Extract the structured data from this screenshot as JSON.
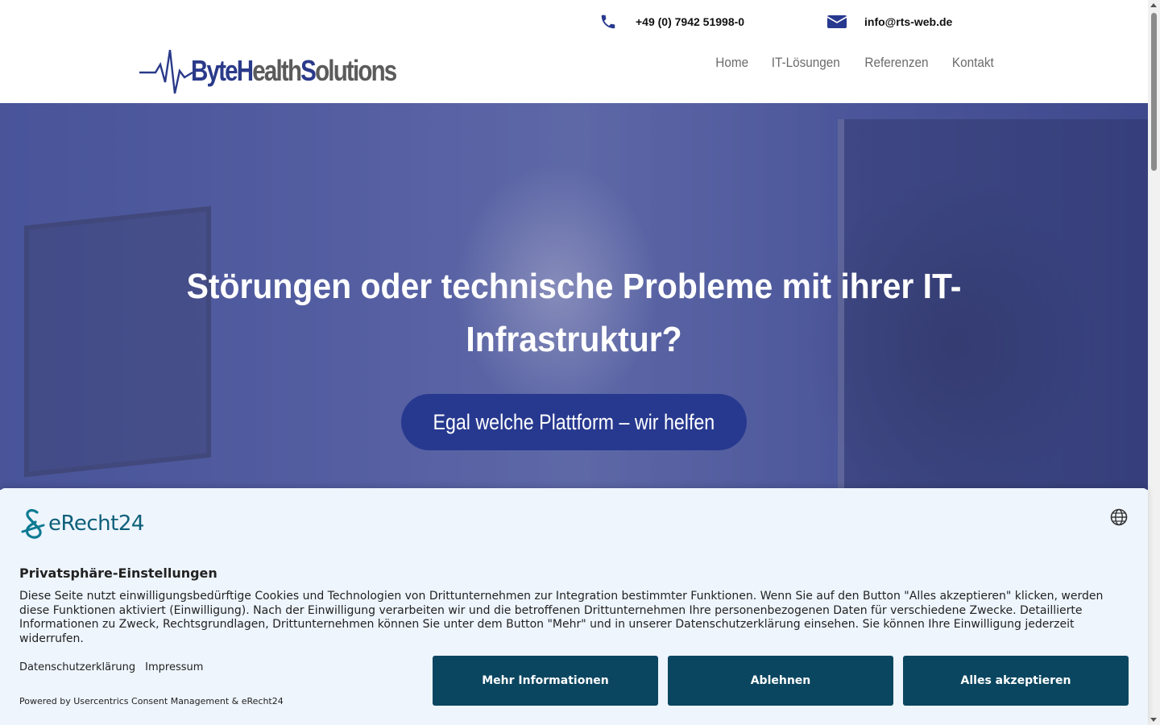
{
  "header": {
    "phone": "+49 (0) 7942 51998-0",
    "email": "info@rts-web.de",
    "logo": {
      "part1": "Byte",
      "part2": "H",
      "part3": "ealth",
      "part4": "S",
      "part5": "olutions"
    },
    "nav": [
      {
        "label": "Home"
      },
      {
        "label": "IT-Lösungen"
      },
      {
        "label": "Referenzen"
      },
      {
        "label": "Kontakt"
      }
    ]
  },
  "hero": {
    "headline": "Störungen oder technische Probleme mit ihrer IT-Infrastruktur?",
    "cta_label": "Egal welche Plattform – wir helfen"
  },
  "consent": {
    "brand": "eRecht24",
    "title": "Privatsphäre-Einstellungen",
    "text": "Diese Seite nutzt einwilligungsbedürftige Cookies und Technologien von Drittunternehmen zur Integration bestimmter Funktionen. Wenn Sie auf den Button \"Alles akzeptieren\" klicken, werden diese Funktionen aktiviert (Einwilligung). Nach der Einwilligung verarbeiten wir und die betroffenen Drittunternehmen Ihre personenbezogenen Daten für verschiedene Zwecke. Detaillierte Informationen zu Zweck, Rechtsgrundlagen, Drittunternehmen können Sie unter dem Button \"Mehr\" und in unserer Datenschutzerklärung einsehen. Sie können Ihre Einwilligung jederzeit widerrufen.",
    "links": [
      {
        "label": "Datenschutzerklärung"
      },
      {
        "label": "Impressum"
      }
    ],
    "powered_by": "Powered by Usercentrics Consent Management & eRecht24",
    "buttons": {
      "more": "Mehr Informationen",
      "decline": "Ablehnen",
      "accept": "Alles akzeptieren"
    }
  },
  "colors": {
    "brand_blue": "#27398f",
    "consent_button": "#0b4660",
    "consent_bg": "#eef5fd",
    "erecht_teal": "#0e5f79"
  },
  "icons": [
    "phone-icon",
    "mail-icon",
    "globe-icon",
    "erecht24-logo-icon",
    "heartbeat-logo-icon"
  ]
}
